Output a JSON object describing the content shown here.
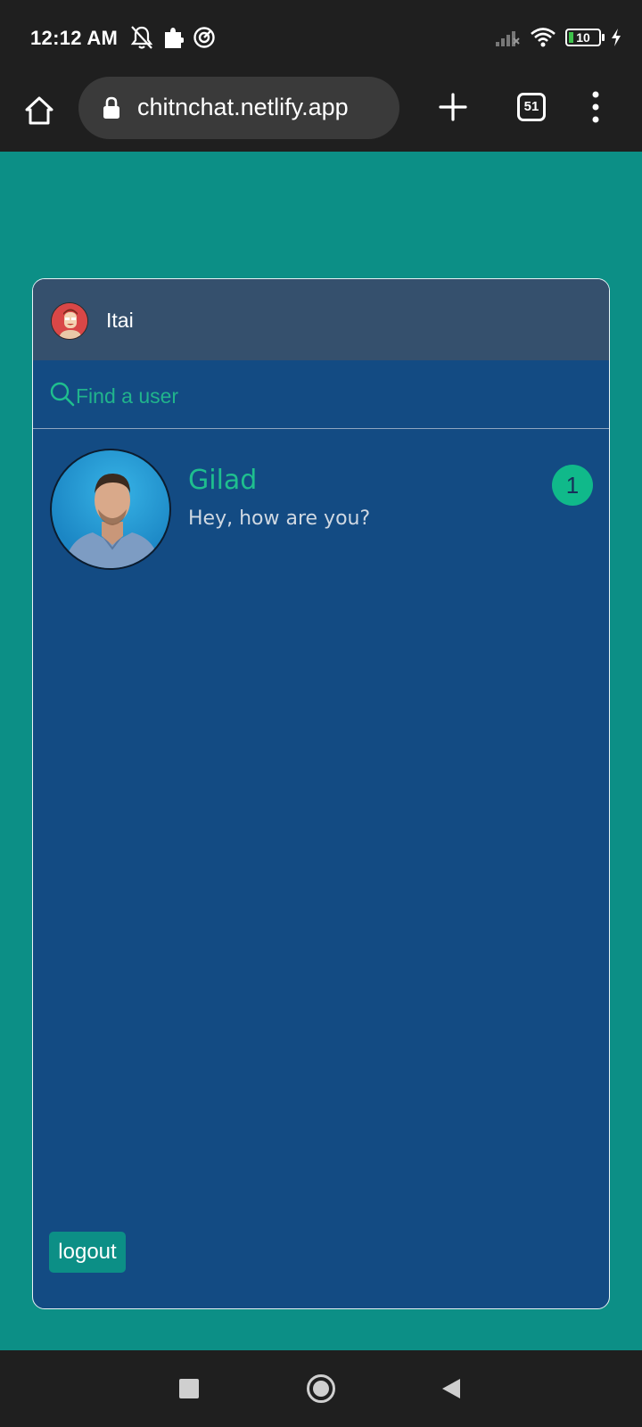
{
  "status_bar": {
    "time": "12:12 AM",
    "battery_level": "10",
    "icons_left": [
      "notifications-off-icon",
      "extension-icon",
      "vpn-icon"
    ],
    "icons_right": [
      "signal-icon",
      "wifi-icon",
      "battery-icon",
      "charging-icon"
    ]
  },
  "browser": {
    "url": "chitnchat.netlify.app",
    "tab_count": "51"
  },
  "app": {
    "profile": {
      "name": "Itai"
    },
    "search": {
      "placeholder": "Find a user"
    },
    "contacts": [
      {
        "name": "Gilad",
        "last_message": "Hey, how are you?",
        "unread": "1"
      }
    ],
    "logout_label": "logout"
  },
  "colors": {
    "background": "#0c8f86",
    "card": "#134b83",
    "header": "#35506d",
    "accent": "#1fbf8e"
  }
}
